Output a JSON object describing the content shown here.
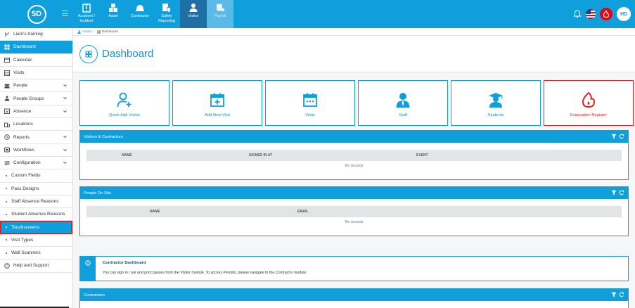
{
  "header": {
    "logo_text": "5D",
    "modules": [
      {
        "label": "Accident / Incident",
        "icon": "clipboard-icon",
        "state": "normal"
      },
      {
        "label": "Asset",
        "icon": "boxes-icon",
        "state": "normal"
      },
      {
        "label": "Contractor",
        "icon": "hardhat-icon",
        "state": "normal"
      },
      {
        "label": "Safety Reporting",
        "icon": "shield-report-icon",
        "state": "normal"
      },
      {
        "label": "Visitor",
        "icon": "person-icon",
        "state": "active"
      },
      {
        "label": "Payroll",
        "icon": "coins-icon",
        "state": "disabled"
      }
    ],
    "avatar_initials": "HD"
  },
  "sidebar": {
    "items": [
      {
        "label": "Liam's training",
        "icon": "branch-icon"
      },
      {
        "label": "Dashboard",
        "icon": "dashboard-icon",
        "active": true
      },
      {
        "label": "Calendar",
        "icon": "calendar-icon"
      },
      {
        "label": "Visits",
        "icon": "list-icon"
      },
      {
        "label": "People",
        "icon": "people-icon",
        "chevron": true
      },
      {
        "label": "People Groups",
        "icon": "groups-icon",
        "chevron": true
      },
      {
        "label": "Absence",
        "icon": "absence-icon",
        "chevron": true
      },
      {
        "label": "Locations",
        "icon": "location-icon"
      },
      {
        "label": "Reports",
        "icon": "reports-icon",
        "chevron": true
      },
      {
        "label": "Workflows",
        "icon": "workflow-icon",
        "chevron": true
      },
      {
        "label": "Configuration",
        "icon": "config-icon",
        "chevron": true
      },
      {
        "label": "Custom Fields",
        "sub": true
      },
      {
        "label": "Pass Designs",
        "sub": true
      },
      {
        "label": "Staff Absence Reasons",
        "sub": true
      },
      {
        "label": "Student Absence Reasons",
        "sub": true
      },
      {
        "label": "Touchscreens",
        "sub": true,
        "selected": true
      },
      {
        "label": "Visit Types",
        "sub": true
      },
      {
        "label": "Wall Scanners",
        "sub": true
      },
      {
        "label": "Help and Support",
        "icon": "help-icon"
      }
    ]
  },
  "breadcrumb": {
    "root": "Visitor",
    "current": "Dashboard"
  },
  "page": {
    "title": "Dashboard"
  },
  "tiles": [
    {
      "label": "Quick Add Visitor",
      "icon": "add-user-icon"
    },
    {
      "label": "Add New Visit",
      "icon": "calendar-plus-icon"
    },
    {
      "label": "Visits",
      "icon": "calendar-dots-icon"
    },
    {
      "label": "Staff",
      "icon": "staff-icon"
    },
    {
      "label": "Students",
      "icon": "graduate-icon"
    },
    {
      "label": "Evacuation Register",
      "icon": "fire-icon"
    }
  ],
  "visitors_panel": {
    "title": "Visitors & Contractors",
    "columns": [
      "NAME",
      "SIGNED IN AT",
      "EVENT"
    ],
    "empty": "No records"
  },
  "people_panel": {
    "title": "People On Site",
    "columns": [
      "NAME",
      "EMAIL"
    ],
    "empty": "No records"
  },
  "contractor_info": {
    "title": "Contractor Dashboard",
    "text": "You can sign in / out and print passes from the Visitor module. To access Permits, please navigate to the Contractor module"
  },
  "contractors_panel": {
    "title": "Contractors"
  },
  "colors": {
    "primary": "#0f9fdc",
    "active_module": "#1f6fa5",
    "alert": "#e30613"
  }
}
